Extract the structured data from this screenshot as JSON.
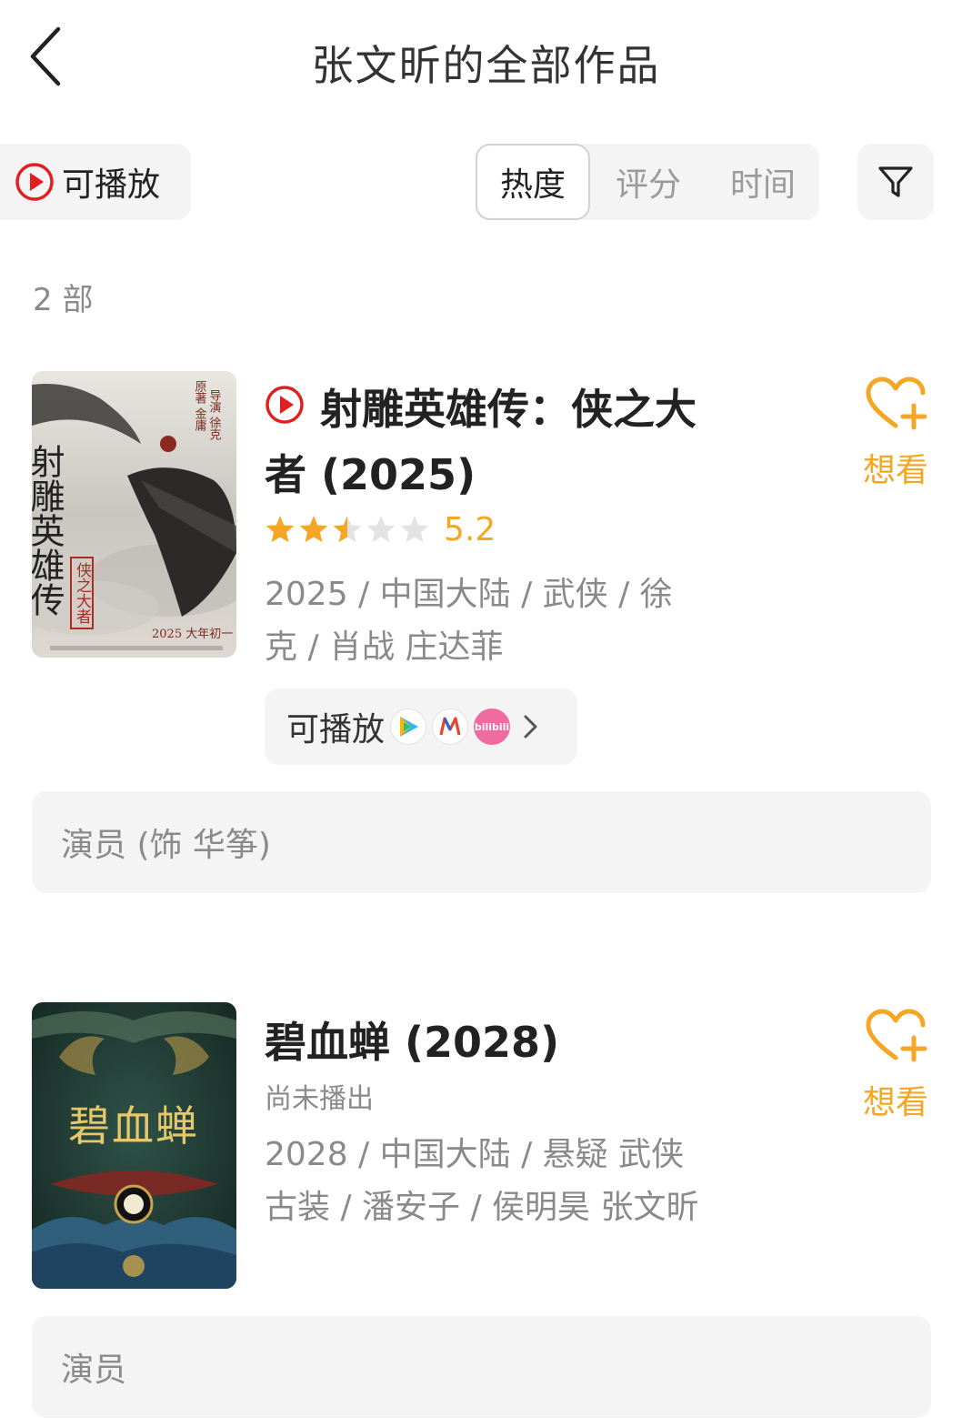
{
  "header": {
    "title": "张文昕的全部作品",
    "back_icon": "chevron-left-icon"
  },
  "toolbar": {
    "playable_label": "可播放",
    "sort_tabs": [
      "热度",
      "评分",
      "时间"
    ],
    "active_sort": "热度",
    "filter_icon": "funnel-icon"
  },
  "count_label": "2 部",
  "colors": {
    "accent_orange": "#f5a623",
    "play_red": "#e02020",
    "muted_text": "#8a8a8a",
    "panel_bg": "#f4f4f4"
  },
  "works": [
    {
      "poster": {
        "title_vertical": "射雕英雄传",
        "subtitle": "侠之大者",
        "credits_col1": "原著 金庸",
        "credits_col2": "导演 徐克",
        "date_line": "2025 大年初一"
      },
      "title_line1": "射雕英雄传：侠之大",
      "title_line2": "者 (2025)",
      "playable": true,
      "rating_value": 5.2,
      "rating_stars": 2.5,
      "rating_text": "5.2",
      "meta_line1": "2025 / 中国大陆 / 武侠 / 徐",
      "meta_line2": "克 / 肖战 庄达菲",
      "platforms_label": "可播放",
      "platform_icons": [
        "tencent-video-icon",
        "mgtv-icon",
        "bilibili-icon"
      ],
      "bilibili_text": "bilibili",
      "wish_label": "想看",
      "role": "演员 (饰 华筝)"
    },
    {
      "poster": {
        "title_vertical": "碧血蝉"
      },
      "title_line1": "碧血蝉 (2028)",
      "status": "尚未播出",
      "meta_line1": "2028 / 中国大陆 / 悬疑 武侠",
      "meta_line2": "古装 / 潘安子 / 侯明昊 张文昕",
      "wish_label": "想看",
      "role": "演员"
    }
  ]
}
